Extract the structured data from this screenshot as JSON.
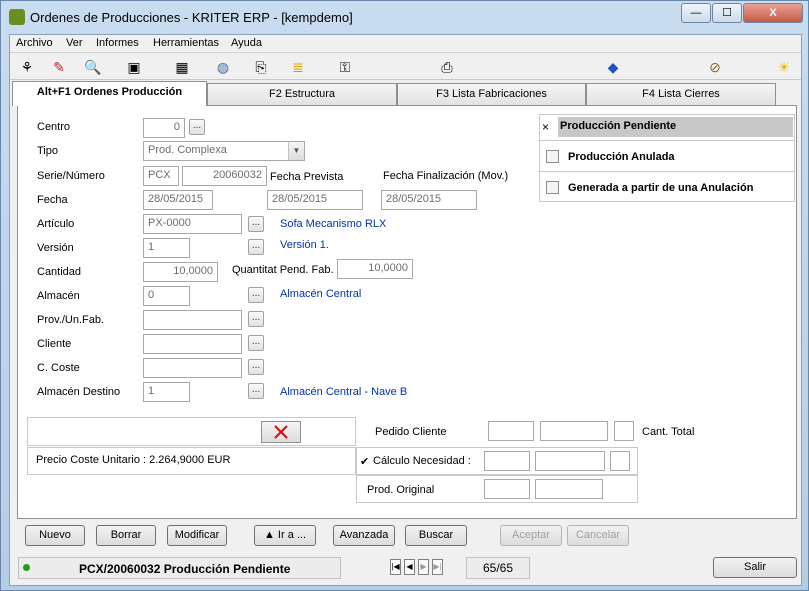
{
  "window": {
    "title": "Ordenes de Producciones - KRITER ERP - [kempdemo]",
    "min_label": "—",
    "max_label": "☐",
    "close_label": "X"
  },
  "menu": [
    "Archivo",
    "Ver",
    "Informes",
    "Herramientas",
    "Ayuda"
  ],
  "toolbar_icons": [
    "tree-icon",
    "wand-icon",
    "preview-icon",
    "search-window-icon",
    "calculator-icon",
    "globe-icon",
    "copy-icon",
    "checklist-icon",
    "key-icon",
    "printer-icon",
    "eraser-icon",
    "paperclip-icon",
    "lightbulb-icon"
  ],
  "tabs": [
    {
      "label": "Alt+F1 Ordenes Producción",
      "active": true
    },
    {
      "label": "F2 Estructura",
      "active": false
    },
    {
      "label": "F3 Lista Fabricaciones",
      "active": false
    },
    {
      "label": "F4 Lista Cierres",
      "active": false
    }
  ],
  "form": {
    "centro_label": "Centro",
    "centro_value": "0",
    "tipo_label": "Tipo",
    "tipo_value": "Prod. Complexa",
    "serie_label": "Serie/Número",
    "serie_value": "PCX",
    "numero_value": "20060032",
    "fecha_prevista_label": "Fecha Prevista",
    "fecha_finalizacion_label": "Fecha Finalización (Mov.)",
    "fecha_label": "Fecha",
    "fecha_value": "28/05/2015",
    "fecha_prevista_value": "28/05/2015",
    "fecha_finalizacion_value": "28/05/2015",
    "articulo_label": "Artículo",
    "articulo_value": "PX-0000",
    "articulo_desc": "Sofa Mecanismo RLX",
    "version_label": "Versión",
    "version_value": "1",
    "version_desc": "Versión 1.",
    "cantidad_label": "Cantidad",
    "cantidad_value": "10,0000",
    "quantitat_label": "Quantitat Pend. Fab.",
    "quantitat_value": "10,0000",
    "almacen_label": "Almacén",
    "almacen_value": "0",
    "almacen_desc": "Almacén Central",
    "prov_label": "Prov./Un.Fab.",
    "prov_value": "",
    "cliente_label": "Cliente",
    "cliente_value": "",
    "ccoste_label": "C. Coste",
    "ccoste_value": "",
    "almacen_destino_label": "Almacén Destino",
    "almacen_destino_value": "1",
    "almacen_destino_desc": "Almacén Central - Nave B",
    "dots": "..."
  },
  "status_options": [
    {
      "mark": "×",
      "label": "Producción Pendiente",
      "selected": true
    },
    {
      "mark": "",
      "label": "Producción Anulada",
      "selected": false
    },
    {
      "mark": "",
      "label": "Generada a partir de una Anulación",
      "selected": false
    }
  ],
  "bottom": {
    "pedido_cliente_label": "Pedido Cliente",
    "cant_total_label": "Cant. Total",
    "precio_coste": "Precio Coste Unitario : 2.264,9000 EUR",
    "calculo_check": "✔",
    "calculo_label": "Cálculo Necesidad :",
    "prod_original_label": "Prod. Original"
  },
  "buttons": {
    "nuevo": "Nuevo",
    "borrar": "Borrar",
    "modificar": "Modificar",
    "ira": "▲ Ir a ...",
    "avanzada": "Avanzada",
    "buscar": "Buscar",
    "aceptar": "Aceptar",
    "cancelar": "Cancelar",
    "salir": "Salir"
  },
  "statusbar": {
    "record_text": "PCX/20060032 Producción Pendiente",
    "position": "65/65"
  },
  "colors": {
    "link": "#0033aa",
    "delete_x": "#d01010",
    "status_dot": "#1a9e1a"
  }
}
